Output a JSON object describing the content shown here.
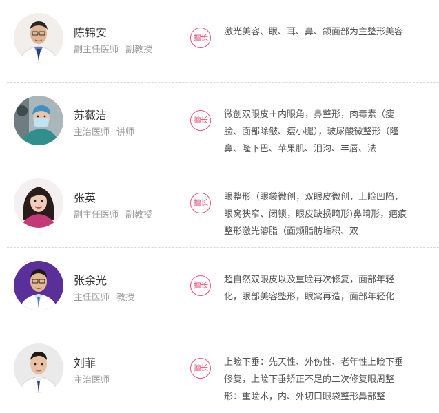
{
  "badge_label": "擅长",
  "doctors": [
    {
      "name": "陈锦安",
      "title": "副主任医师",
      "academic": "副教授",
      "specialty": "激光美容、眼、耳、鼻、颌面部为主整形美容",
      "avatar": "doctor-white-coat-glasses"
    },
    {
      "name": "苏薇洁",
      "title": "主治医师",
      "academic": "讲师",
      "specialty": "微创双眼皮＋内眼角，鼻整形，肉毒素（瘦脸、面部除皱、瘦小腿），玻尿酸微整形（隆鼻、隆下巴、苹果肌、泪沟、丰唇、法",
      "avatar": "doctor-surgical-cap-mask"
    },
    {
      "name": "张英",
      "title": "副主任医师",
      "academic": "副教授",
      "specialty": "眼整形（眼袋微创，双眼皮微创，上睑凹陷，眼窝狭窄、闭锁，眼皮缺损畸形)鼻畸形，疤痕整形激光溶脂（面颊脂肪堆积、双",
      "avatar": "doctor-woman-long-hair"
    },
    {
      "name": "张余光",
      "title": "主任医师",
      "academic": "教授",
      "specialty": "超自然双眼皮以及重睑再次修复，面部年轻化，眼部美容整形，眼窝再造，面部年轻化",
      "avatar": "doctor-purple-background-glasses"
    },
    {
      "name": "刘菲",
      "title": "主治医师",
      "academic": "",
      "specialty": "上睑下垂：先天性、外伤性、老年性上睑下垂修复，上睑下垂矫正不足的二次修复眼周整形：重睑术，内、外切口眼袋整形鼻部整",
      "avatar": "doctor-white-coat-tie"
    }
  ]
}
